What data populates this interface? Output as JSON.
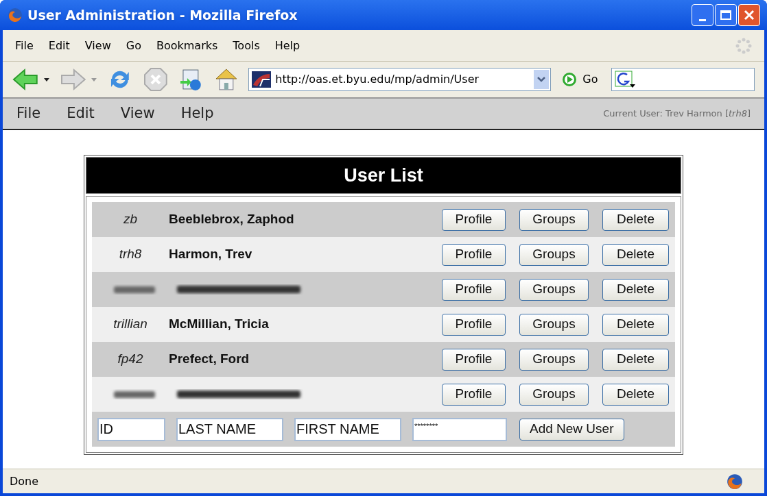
{
  "window": {
    "title": "User Administration - Mozilla Firefox"
  },
  "browser_menu": [
    "File",
    "Edit",
    "View",
    "Go",
    "Bookmarks",
    "Tools",
    "Help"
  ],
  "address_bar": {
    "value": "http://oas.et.byu.edu/mp/admin/User"
  },
  "go_button": "Go",
  "app_menu": [
    "File",
    "Edit",
    "View",
    "Help"
  ],
  "current_user": {
    "label": "Current User: Trev Harmon [",
    "id": "trh8",
    "close": "]"
  },
  "panel": {
    "title": "User List"
  },
  "users": [
    {
      "kind": "user",
      "id": "zb",
      "name": "Beeblebrox, Zaphod",
      "buttons": [
        "Profile",
        "Groups",
        "Delete"
      ]
    },
    {
      "kind": "user",
      "id": "trh8",
      "name": "Harmon, Trev",
      "buttons": [
        "Profile",
        "Groups",
        "Delete"
      ]
    },
    {
      "kind": "redacted",
      "buttons": [
        "Profile",
        "Groups",
        "Delete"
      ]
    },
    {
      "kind": "user",
      "id": "trillian",
      "name": "McMillian, Tricia",
      "buttons": [
        "Profile",
        "Groups",
        "Delete"
      ]
    },
    {
      "kind": "user",
      "id": "fp42",
      "name": "Prefect, Ford",
      "buttons": [
        "Profile",
        "Groups",
        "Delete"
      ]
    },
    {
      "kind": "redacted",
      "buttons": [
        "Profile",
        "Groups",
        "Delete"
      ]
    }
  ],
  "new_user": {
    "fields": [
      {
        "kind": "text",
        "value": "ID"
      },
      {
        "kind": "text",
        "value": "LAST NAME"
      },
      {
        "kind": "text",
        "value": "FIRST NAME"
      },
      {
        "kind": "password",
        "value": "********"
      }
    ],
    "button": "Add New User"
  },
  "status_bar": {
    "text": "Done"
  }
}
